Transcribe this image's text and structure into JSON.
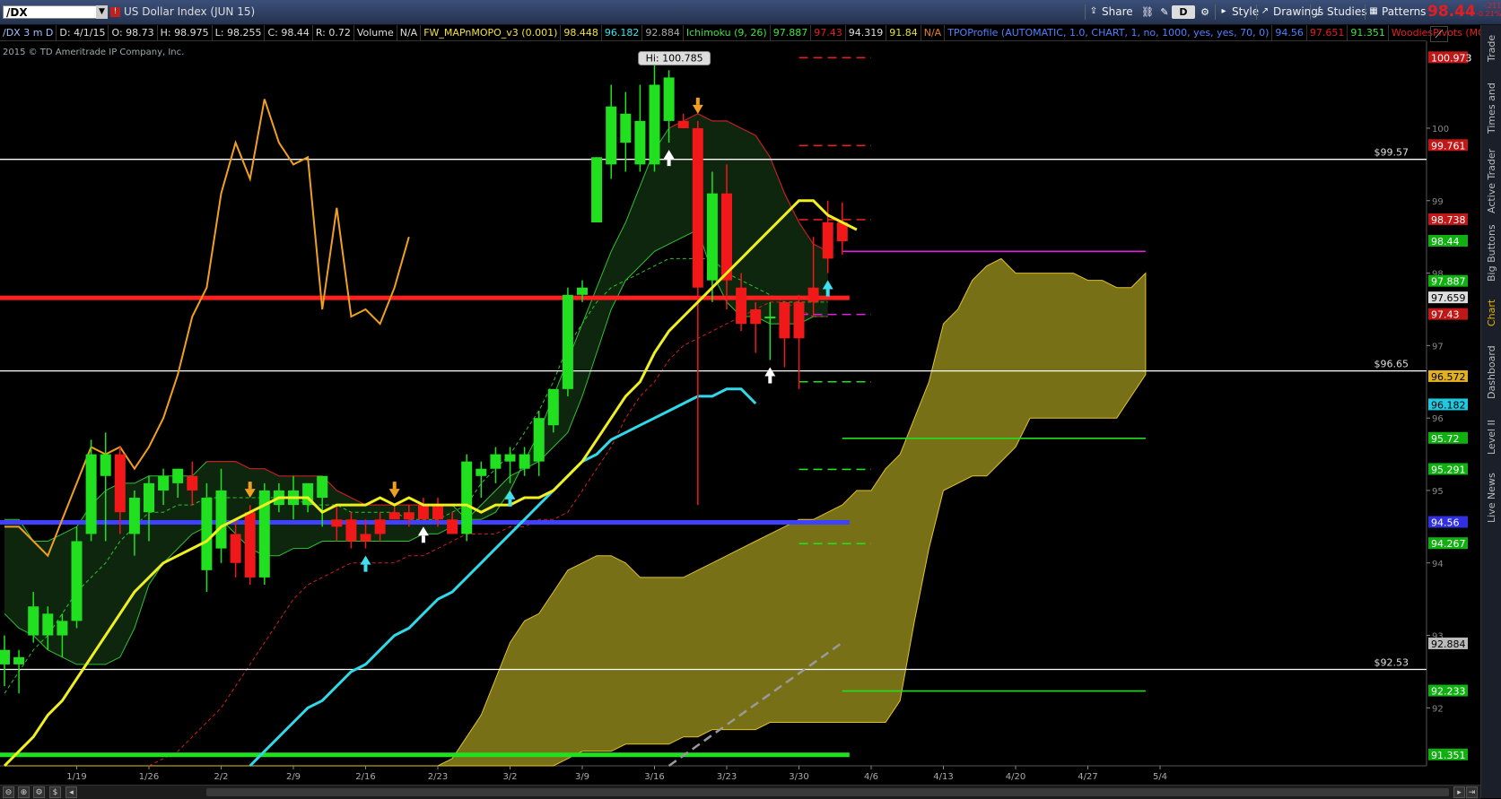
{
  "toolbar": {
    "symbol": "/DX",
    "description": "US Dollar Index (JUN 15)",
    "share": "Share",
    "style": "Style",
    "drawings": "Drawings",
    "studies": "Studies",
    "patterns": "Patterns",
    "period_button": "D",
    "last_price": "98.44",
    "change_abs": "-.211",
    "change_pct": "-0.21%"
  },
  "study_bar": [
    {
      "text": "/DX 3 m D",
      "color": "#9ec0ff"
    },
    {
      "text": "D: 4/1/15",
      "color": "#dddddd"
    },
    {
      "text": "O: 98.73",
      "color": "#dddddd"
    },
    {
      "text": "H: 98.975",
      "color": "#dddddd"
    },
    {
      "text": "L: 98.255",
      "color": "#dddddd"
    },
    {
      "text": "C: 98.44",
      "color": "#dddddd"
    },
    {
      "text": "R: 0.72",
      "color": "#dddddd"
    },
    {
      "text": "Volume",
      "color": "#dddddd"
    },
    {
      "text": "N/A",
      "color": "#dddddd"
    },
    {
      "text": "FW_MAPnMOPO_v3 (0.001)",
      "color": "#f0e040"
    },
    {
      "text": "98.448",
      "color": "#f0e040"
    },
    {
      "text": "96.182",
      "color": "#40e0e8"
    },
    {
      "text": "92.884",
      "color": "#aaaaaa"
    },
    {
      "text": "Ichimoku (9, 26)",
      "color": "#40e040"
    },
    {
      "text": "97.887",
      "color": "#40e040"
    },
    {
      "text": "97.43",
      "color": "#e02020"
    },
    {
      "text": "94.319",
      "color": "#dddddd"
    },
    {
      "text": "91.84",
      "color": "#e0e040"
    },
    {
      "text": "N/A",
      "color": "#e08020"
    },
    {
      "text": "TPOProfile (AUTOMATIC, 1.0, CHART, 1, no, 1000, yes, yes, 70, 0)",
      "color": "#5080ff"
    },
    {
      "text": "94.56",
      "color": "#5080ff"
    },
    {
      "text": "97.651",
      "color": "#e02020"
    },
    {
      "text": "91.351",
      "color": "#40e040"
    },
    {
      "text": "WoodiesPivots (MONTH, yes)",
      "color": "#e02020"
    }
  ],
  "copyright": "2015 © TD Ameritrade IP Company, Inc.",
  "right_tabs": [
    "Trade",
    "Times and Sales",
    "Active Trader",
    "Big Buttons",
    "Chart",
    "Dashboard",
    "Level II",
    "Live News"
  ],
  "chart_data": {
    "type": "candlestick",
    "ylim": [
      91.2,
      101.2
    ],
    "xlim": [
      0,
      81
    ],
    "x_ticks": [
      {
        "label": "1/19",
        "i": 5
      },
      {
        "label": "1/26",
        "i": 10
      },
      {
        "label": "2/2",
        "i": 15
      },
      {
        "label": "2/9",
        "i": 20
      },
      {
        "label": "2/16",
        "i": 25
      },
      {
        "label": "2/23",
        "i": 30
      },
      {
        "label": "3/2",
        "i": 35
      },
      {
        "label": "3/9",
        "i": 40
      },
      {
        "label": "3/16",
        "i": 45
      },
      {
        "label": "3/23",
        "i": 50
      },
      {
        "label": "3/30",
        "i": 55
      },
      {
        "label": "4/6",
        "i": 60
      },
      {
        "label": "4/13",
        "i": 65
      },
      {
        "label": "4/20",
        "i": 70
      },
      {
        "label": "4/27",
        "i": 75
      },
      {
        "label": "5/4",
        "i": 80
      }
    ],
    "y_ticks": [
      92,
      93,
      94,
      95,
      96,
      97,
      98,
      99,
      100
    ],
    "candles": [
      {
        "o": 92.6,
        "h": 93.0,
        "l": 92.3,
        "c": 92.8
      },
      {
        "o": 92.6,
        "h": 92.8,
        "l": 92.2,
        "c": 92.7
      },
      {
        "o": 93.0,
        "h": 93.6,
        "l": 92.9,
        "c": 93.4
      },
      {
        "o": 93.0,
        "h": 93.4,
        "l": 92.8,
        "c": 93.3
      },
      {
        "o": 93.0,
        "h": 93.3,
        "l": 92.7,
        "c": 93.2
      },
      {
        "o": 93.2,
        "h": 94.5,
        "l": 93.1,
        "c": 94.3
      },
      {
        "o": 94.4,
        "h": 95.7,
        "l": 94.3,
        "c": 95.5
      },
      {
        "o": 95.2,
        "h": 95.8,
        "l": 94.3,
        "c": 95.5
      },
      {
        "o": 95.5,
        "h": 95.6,
        "l": 94.4,
        "c": 94.7
      },
      {
        "o": 94.4,
        "h": 95.0,
        "l": 94.1,
        "c": 94.9
      },
      {
        "o": 94.7,
        "h": 95.2,
        "l": 94.3,
        "c": 95.1
      },
      {
        "o": 95.0,
        "h": 95.3,
        "l": 94.8,
        "c": 95.2
      },
      {
        "o": 95.1,
        "h": 95.3,
        "l": 94.9,
        "c": 95.3
      },
      {
        "o": 95.2,
        "h": 95.4,
        "l": 94.8,
        "c": 95.0
      },
      {
        "o": 93.9,
        "h": 95.1,
        "l": 93.6,
        "c": 94.9
      },
      {
        "o": 94.2,
        "h": 95.3,
        "l": 94.0,
        "c": 95.0
      },
      {
        "o": 94.4,
        "h": 94.6,
        "l": 93.8,
        "c": 94.0
      },
      {
        "o": 94.7,
        "h": 94.8,
        "l": 93.7,
        "c": 93.8
      },
      {
        "o": 93.8,
        "h": 95.1,
        "l": 93.7,
        "c": 95.0
      },
      {
        "o": 94.8,
        "h": 95.1,
        "l": 94.7,
        "c": 95.0
      },
      {
        "o": 94.8,
        "h": 95.2,
        "l": 94.6,
        "c": 95.0
      },
      {
        "o": 94.8,
        "h": 95.1,
        "l": 94.7,
        "c": 95.1
      },
      {
        "o": 94.9,
        "h": 95.2,
        "l": 94.5,
        "c": 95.2
      },
      {
        "o": 94.6,
        "h": 94.8,
        "l": 94.3,
        "c": 94.5
      },
      {
        "o": 94.6,
        "h": 94.7,
        "l": 94.2,
        "c": 94.3
      },
      {
        "o": 94.4,
        "h": 94.6,
        "l": 94.2,
        "c": 94.3
      },
      {
        "o": 94.6,
        "h": 94.7,
        "l": 94.3,
        "c": 94.4
      },
      {
        "o": 94.7,
        "h": 94.8,
        "l": 94.6,
        "c": 94.6
      },
      {
        "o": 94.7,
        "h": 94.8,
        "l": 94.5,
        "c": 94.6
      },
      {
        "o": 94.8,
        "h": 94.9,
        "l": 94.6,
        "c": 94.6
      },
      {
        "o": 94.8,
        "h": 94.9,
        "l": 94.5,
        "c": 94.6
      },
      {
        "o": 94.6,
        "h": 94.7,
        "l": 94.4,
        "c": 94.4
      },
      {
        "o": 94.4,
        "h": 95.5,
        "l": 94.3,
        "c": 95.4
      },
      {
        "o": 95.2,
        "h": 95.4,
        "l": 94.9,
        "c": 95.3
      },
      {
        "o": 95.3,
        "h": 95.6,
        "l": 95.1,
        "c": 95.5
      },
      {
        "o": 95.4,
        "h": 95.6,
        "l": 95.1,
        "c": 95.5
      },
      {
        "o": 95.3,
        "h": 95.6,
        "l": 95.2,
        "c": 95.5
      },
      {
        "o": 95.4,
        "h": 96.1,
        "l": 95.2,
        "c": 96.0
      },
      {
        "o": 95.9,
        "h": 96.4,
        "l": 95.8,
        "c": 96.4
      },
      {
        "o": 96.4,
        "h": 97.8,
        "l": 96.3,
        "c": 97.7
      },
      {
        "o": 97.7,
        "h": 97.9,
        "l": 97.6,
        "c": 97.8
      },
      {
        "o": 98.7,
        "h": 99.6,
        "l": 98.7,
        "c": 99.6
      },
      {
        "o": 99.5,
        "h": 100.6,
        "l": 99.3,
        "c": 100.3
      },
      {
        "o": 99.8,
        "h": 100.5,
        "l": 99.4,
        "c": 100.2
      },
      {
        "o": 99.5,
        "h": 100.6,
        "l": 99.4,
        "c": 100.1
      },
      {
        "o": 99.5,
        "h": 100.9,
        "l": 99.4,
        "c": 100.6
      },
      {
        "o": 100.1,
        "h": 100.8,
        "l": 99.8,
        "c": 100.7
      },
      {
        "o": 100.1,
        "h": 100.2,
        "l": 100.0,
        "c": 100.0
      },
      {
        "o": 100.0,
        "h": 100.1,
        "l": 94.8,
        "c": 97.8
      },
      {
        "o": 97.9,
        "h": 99.4,
        "l": 97.6,
        "c": 99.1
      },
      {
        "o": 99.1,
        "h": 99.5,
        "l": 97.5,
        "c": 97.9
      },
      {
        "o": 97.8,
        "h": 98.0,
        "l": 97.2,
        "c": 97.3
      },
      {
        "o": 97.5,
        "h": 97.6,
        "l": 96.9,
        "c": 97.3
      },
      {
        "o": 97.4,
        "h": 97.6,
        "l": 96.8,
        "c": 97.4
      },
      {
        "o": 97.6,
        "h": 97.6,
        "l": 96.7,
        "c": 97.1
      },
      {
        "o": 97.6,
        "h": 97.7,
        "l": 96.4,
        "c": 97.1
      },
      {
        "o": 97.8,
        "h": 98.5,
        "l": 97.4,
        "c": 97.6
      },
      {
        "o": 98.7,
        "h": 99.0,
        "l": 98.0,
        "c": 98.2
      },
      {
        "o": 98.7,
        "h": 98.975,
        "l": 98.255,
        "c": 98.44
      }
    ],
    "last_candle_index": 58,
    "orange_line": [
      94.5,
      94.5,
      94.3,
      94.1,
      94.6,
      95.1,
      95.6,
      95.5,
      95.6,
      95.3,
      95.6,
      96.0,
      96.6,
      97.4,
      97.8,
      99.1,
      99.8,
      99.3,
      100.4,
      99.8,
      99.5,
      99.6,
      97.5,
      98.9,
      97.4,
      97.5,
      97.3,
      97.8,
      98.5
    ],
    "yellow_ma": [
      91.2,
      91.4,
      91.6,
      91.9,
      92.1,
      92.4,
      92.7,
      93.0,
      93.3,
      93.6,
      93.8,
      94.0,
      94.1,
      94.2,
      94.3,
      94.5,
      94.6,
      94.7,
      94.8,
      94.9,
      94.9,
      94.9,
      94.7,
      94.8,
      94.8,
      94.8,
      94.9,
      94.8,
      94.9,
      94.8,
      94.8,
      94.8,
      94.8,
      94.7,
      94.8,
      94.8,
      94.9,
      94.9,
      95.0,
      95.2,
      95.4,
      95.7,
      96.0,
      96.3,
      96.5,
      96.9,
      97.2,
      97.4,
      97.6,
      97.8,
      98.0,
      98.2,
      98.4,
      98.6,
      98.8,
      99.0,
      99.0,
      98.8,
      98.7,
      98.6
    ],
    "cyan_ma_start_i": 17,
    "cyan_ma": [
      91.2,
      91.4,
      91.6,
      91.8,
      92.0,
      92.1,
      92.3,
      92.5,
      92.6,
      92.8,
      93.0,
      93.1,
      93.3,
      93.5,
      93.6,
      93.8,
      94.0,
      94.2,
      94.4,
      94.6,
      94.8,
      95.0,
      95.2,
      95.4,
      95.5,
      95.7,
      95.8,
      95.9,
      96.0,
      96.1,
      96.2,
      96.3,
      96.3,
      96.4,
      96.4,
      96.2
    ],
    "gray_dashed_line": {
      "i0": 46,
      "v0": 91.2,
      "i1": 58,
      "v1": 92.9
    },
    "horizontal_levels": [
      {
        "v": 99.57,
        "color": "#ffffff",
        "label": "$99.57"
      },
      {
        "v": 96.65,
        "color": "#ffffff",
        "label": "$96.65"
      },
      {
        "v": 92.53,
        "color": "#ffffff",
        "label": "$92.53"
      }
    ],
    "tpo_lines": [
      {
        "v": 97.659,
        "color": "#ff2020",
        "width": 5,
        "to_i": 58
      },
      {
        "v": 94.56,
        "color": "#4040ff",
        "width": 5,
        "to_i": 58
      },
      {
        "v": 91.351,
        "color": "#20e020",
        "width": 5,
        "to_i": 58
      }
    ],
    "pivot_segments": [
      {
        "v": 100.973,
        "color": "#e02020",
        "dash": true,
        "i0": 55,
        "i1": 60
      },
      {
        "v": 99.761,
        "color": "#e02020",
        "dash": true,
        "i0": 55,
        "i1": 60
      },
      {
        "v": 98.738,
        "color": "#e02020",
        "dash": true,
        "i0": 55,
        "i1": 60
      },
      {
        "v": 98.3,
        "color": "#e020e0",
        "dash": false,
        "i0": 58,
        "i1": 79
      },
      {
        "v": 97.43,
        "color": "#e020e0",
        "dash": true,
        "i0": 55,
        "i1": 60
      },
      {
        "v": 96.5,
        "color": "#20e020",
        "dash": true,
        "i0": 55,
        "i1": 60
      },
      {
        "v": 95.72,
        "color": "#20e020",
        "dash": false,
        "i0": 58,
        "i1": 79
      },
      {
        "v": 95.291,
        "color": "#20e020",
        "dash": true,
        "i0": 55,
        "i1": 60
      },
      {
        "v": 94.267,
        "color": "#20e020",
        "dash": true,
        "i0": 55,
        "i1": 60
      },
      {
        "v": 92.233,
        "color": "#20e020",
        "dash": false,
        "i0": 58,
        "i1": 79
      }
    ],
    "cloud_top": [
      91.2,
      91.2,
      91.2,
      91.2,
      91.2,
      91.2,
      91.2,
      91.2,
      91.2,
      91.2,
      91.2,
      91.2,
      91.2,
      91.2,
      91.2,
      91.2,
      91.2,
      91.2,
      91.2,
      91.2,
      91.2,
      91.2,
      91.2,
      91.2,
      91.2,
      91.2,
      91.2,
      91.2,
      91.2,
      91.2,
      91.2,
      91.3,
      91.6,
      91.9,
      92.4,
      92.9,
      93.2,
      93.3,
      93.6,
      93.9,
      94.0,
      94.1,
      94.1,
      94.0,
      93.8,
      93.8,
      93.8,
      93.8,
      93.9,
      94.0,
      94.1,
      94.2,
      94.3,
      94.4,
      94.5,
      94.6,
      94.6,
      94.7,
      94.8,
      95.0,
      95.0,
      95.3,
      95.5,
      96.0,
      96.5,
      97.3,
      97.5,
      97.9,
      98.1,
      98.2,
      98.0,
      98.0,
      98.0,
      98.0,
      98.0,
      97.9,
      97.9,
      97.8,
      97.8,
      98.0
    ],
    "cloud_bottom": [
      91.2,
      91.2,
      91.2,
      91.2,
      91.2,
      91.2,
      91.2,
      91.2,
      91.2,
      91.2,
      91.2,
      91.2,
      91.2,
      91.2,
      91.2,
      91.2,
      91.2,
      91.2,
      91.2,
      91.2,
      91.2,
      91.2,
      91.2,
      91.2,
      91.2,
      91.2,
      91.2,
      91.2,
      91.2,
      91.2,
      91.2,
      91.2,
      91.2,
      91.2,
      91.2,
      91.2,
      91.2,
      91.2,
      91.2,
      91.3,
      91.4,
      91.4,
      91.4,
      91.5,
      91.5,
      91.5,
      91.5,
      91.6,
      91.6,
      91.7,
      91.7,
      91.7,
      91.7,
      91.8,
      91.8,
      91.8,
      91.8,
      91.8,
      91.8,
      91.8,
      91.8,
      91.8,
      92.1,
      93.2,
      94.2,
      95.0,
      95.1,
      95.2,
      95.2,
      95.4,
      95.6,
      96.0,
      96.0,
      96.0,
      96.0,
      96.0,
      96.0,
      96.0,
      96.3,
      96.6
    ],
    "kumo_upper": [
      94.6,
      94.6,
      94.3,
      94.3,
      94.4,
      94.5,
      94.8,
      95.0,
      95.1,
      95.1,
      95.2,
      95.2,
      95.2,
      95.2,
      95.4,
      95.4,
      95.4,
      95.3,
      95.3,
      95.2,
      95.2,
      95.2,
      95.2,
      95.0,
      94.9,
      94.8,
      94.8,
      94.8,
      94.8,
      94.8,
      94.8,
      94.8,
      94.6,
      94.6,
      94.7,
      95.0,
      95.4,
      95.8,
      96.3,
      96.8,
      97.3,
      97.8,
      98.3,
      98.7,
      99.2,
      99.7,
      100.0,
      100.1,
      100.2,
      100.1,
      100.1,
      100.0,
      99.9,
      99.6,
      99.1,
      98.7,
      98.4,
      98.3
    ],
    "kumo_lower": [
      93.3,
      93.1,
      93.0,
      92.8,
      92.7,
      92.6,
      92.6,
      92.6,
      92.7,
      93.1,
      93.7,
      94.0,
      94.2,
      94.4,
      94.5,
      94.6,
      94.4,
      94.2,
      94.1,
      94.1,
      94.2,
      94.2,
      94.3,
      94.3,
      94.3,
      94.3,
      94.3,
      94.3,
      94.3,
      94.4,
      94.4,
      94.5,
      94.6,
      94.8,
      95.0,
      95.2,
      95.3,
      95.4,
      95.6,
      95.8,
      96.3,
      96.9,
      97.5,
      97.9,
      98.1,
      98.3,
      98.4,
      98.5,
      98.6,
      98.0,
      97.6,
      97.4,
      97.4,
      97.3,
      97.3,
      97.3,
      97.4,
      97.4
    ],
    "kijun_dashed": [
      92.2,
      92.5,
      92.8,
      93.0,
      93.3,
      93.6,
      93.8,
      94.0,
      94.3,
      94.5,
      94.7,
      94.7,
      94.8,
      94.8,
      94.9,
      94.9,
      94.9,
      94.9,
      94.9,
      94.9,
      94.9,
      94.8,
      94.8,
      94.8,
      94.7,
      94.7,
      94.7,
      94.7,
      94.6,
      94.6,
      94.6,
      94.7,
      94.8,
      95.1,
      95.3,
      95.5,
      95.8,
      96.1,
      96.5,
      97.0,
      97.3,
      97.6,
      97.8,
      97.9,
      98.0,
      98.1,
      98.2,
      98.2,
      98.2,
      98.2,
      98.0,
      97.9,
      97.8,
      97.7,
      97.6,
      97.6,
      97.6,
      97.6
    ],
    "red_dashed": [
      91.2,
      91.3,
      91.4,
      91.6,
      91.8,
      92.0,
      92.3,
      92.6,
      92.9,
      93.2,
      93.5,
      93.7,
      93.8,
      93.9,
      94.0,
      94.0,
      94.0,
      94.0,
      94.1,
      94.1,
      94.2,
      94.3,
      94.4,
      94.4,
      94.4,
      94.5,
      94.5,
      94.6,
      94.6,
      94.7,
      95.0,
      95.3,
      95.6,
      96.0,
      96.3,
      96.5,
      96.8,
      97.0,
      97.1,
      97.2,
      97.3,
      97.4,
      97.5,
      97.6,
      97.6,
      97.5,
      97.4,
      97.4
    ],
    "red_dashed_start_i": 10,
    "arrows": [
      {
        "i": 17,
        "dir": "down",
        "color": "#f0a020"
      },
      {
        "i": 25,
        "dir": "up",
        "color": "#40e0f0"
      },
      {
        "i": 27,
        "dir": "down",
        "color": "#f0a020"
      },
      {
        "i": 29,
        "dir": "up",
        "color": "#ffffff"
      },
      {
        "i": 35,
        "dir": "up",
        "color": "#40e0f0"
      },
      {
        "i": 46,
        "dir": "up",
        "color": "#ffffff"
      },
      {
        "i": 48,
        "dir": "down",
        "color": "#f0a020"
      },
      {
        "i": 53,
        "dir": "up",
        "color": "#ffffff"
      },
      {
        "i": 57,
        "dir": "up",
        "color": "#40e0f0"
      }
    ],
    "hi_label": {
      "i": 46,
      "v": 100.785,
      "text": "Hi: 100.785"
    },
    "right_price_labels": [
      {
        "v": 100.973,
        "text": "100.973",
        "bg": "#c01818",
        "fg": "#ffffff"
      },
      {
        "v": 99.761,
        "text": "99.761",
        "bg": "#c01818",
        "fg": "#ffffff"
      },
      {
        "v": 98.738,
        "text": "98.738",
        "bg": "#c01818",
        "fg": "#ffffff"
      },
      {
        "v": 98.44,
        "text": "98.44",
        "bg": "#10b010",
        "fg": "#ffffff"
      },
      {
        "v": 97.887,
        "text": "97.887",
        "bg": "#10b010",
        "fg": "#ffffff"
      },
      {
        "v": 97.659,
        "text": "97.659",
        "bg": "#dddddd",
        "fg": "#000000"
      },
      {
        "v": 97.43,
        "text": "97.43",
        "bg": "#c01818",
        "fg": "#ffffff"
      },
      {
        "v": 96.572,
        "text": "96.572",
        "bg": "#e0b020",
        "fg": "#000000"
      },
      {
        "v": 96.182,
        "text": "96.182",
        "bg": "#20c8e0",
        "fg": "#000000"
      },
      {
        "v": 95.72,
        "text": "95.72",
        "bg": "#10b010",
        "fg": "#ffffff"
      },
      {
        "v": 95.291,
        "text": "95.291",
        "bg": "#10b010",
        "fg": "#ffffff"
      },
      {
        "v": 94.56,
        "text": "94.56",
        "bg": "#3030e0",
        "fg": "#ffffff"
      },
      {
        "v": 94.267,
        "text": "94.267",
        "bg": "#10b010",
        "fg": "#ffffff"
      },
      {
        "v": 92.884,
        "text": "92.884",
        "bg": "#bbbbbb",
        "fg": "#000000"
      },
      {
        "v": 92.233,
        "text": "92.233",
        "bg": "#10b010",
        "fg": "#ffffff"
      },
      {
        "v": 91.351,
        "text": "91.351",
        "bg": "#10b010",
        "fg": "#ffffff"
      }
    ]
  }
}
